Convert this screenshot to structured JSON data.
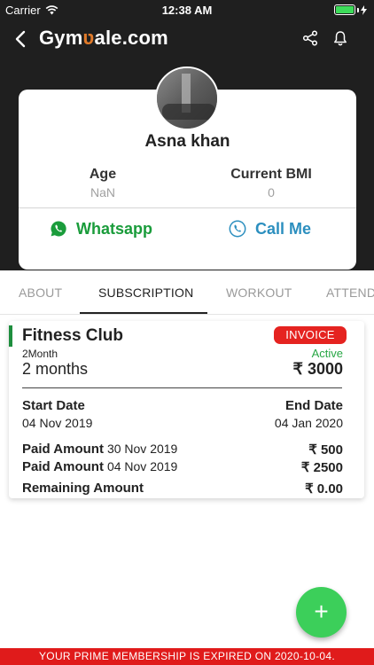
{
  "status_bar": {
    "carrier": "Carrier",
    "time": "12:38 AM"
  },
  "nav": {
    "logo_prefix": "Gym",
    "logo_mark": "ʋ",
    "logo_suffix": "ale.com",
    "back_icon": "chevron-left-icon",
    "share_icon": "share-icon",
    "bell_icon": "bell-icon"
  },
  "profile": {
    "name": "Asna khan",
    "age_label": "Age",
    "age_value": "NaN",
    "bmi_label": "Current BMI",
    "bmi_value": "0",
    "whatsapp_label": "Whatsapp",
    "call_label": "Call Me"
  },
  "tabs": [
    {
      "label": "ABOUT"
    },
    {
      "label": "SUBSCRIPTION"
    },
    {
      "label": "WORKOUT"
    },
    {
      "label": "ATTEND"
    }
  ],
  "subscription": {
    "club_name": "Fitness Club",
    "duration_label": "2Month",
    "duration": "2 months",
    "invoice_label": "INVOICE",
    "status": "Active",
    "price": "₹ 3000",
    "start_label": "Start Date",
    "start_date": "04 Nov 2019",
    "end_label": "End Date",
    "end_date": "04 Jan 2020",
    "payments": [
      {
        "label": "Paid Amount",
        "date": "30 Nov 2019",
        "amount": "₹ 500"
      },
      {
        "label": "Paid Amount",
        "date": "04 Nov 2019",
        "amount": "₹ 2500"
      }
    ],
    "remaining_label": "Remaining Amount",
    "remaining_amount": "₹ 0.00"
  },
  "fab_label": "+",
  "banner": "YOUR PRIME MEMBERSHIP IS EXPIRED ON 2020-10-04.",
  "colors": {
    "header": "#1f1f1f",
    "whatsapp": "#1a9c3b",
    "call": "#2c8fbf",
    "invoice": "#e52320",
    "active": "#28a745",
    "fab": "#3ccf5a",
    "banner": "#e01b1b"
  }
}
